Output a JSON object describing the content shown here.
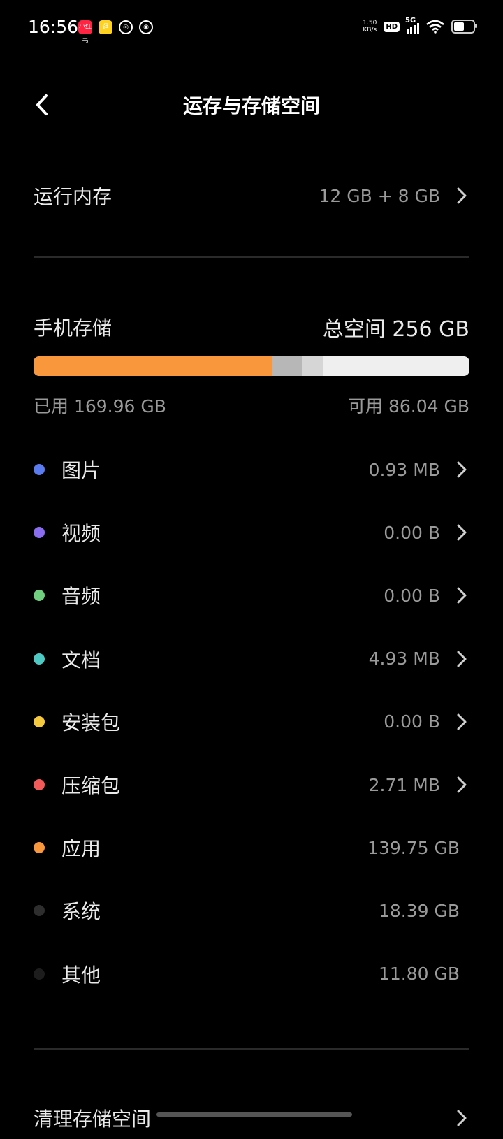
{
  "status_bar": {
    "time": "16:56",
    "notifications": [
      {
        "name": "xiaohongshu-icon",
        "glyph": "小红书",
        "color": "#ff2442"
      },
      {
        "name": "shopping-app-icon",
        "glyph": "逛",
        "color": "#ffd21f"
      },
      {
        "name": "swirl-app-icon",
        "glyph": "◎",
        "color": "#000000"
      },
      {
        "name": "cat-app-icon",
        "glyph": "◉",
        "color": "#000000"
      }
    ],
    "net_speed_value": "1.50",
    "net_speed_unit": "KB/s",
    "hd_label": "HD",
    "signal_label": "5G"
  },
  "header": {
    "title": "运存与存储空间"
  },
  "ram": {
    "label": "运行内存",
    "value": "12 GB + 8 GB"
  },
  "storage": {
    "label": "手机存储",
    "total": "总空间 256 GB",
    "used": "已用 169.96 GB",
    "free": "可用 86.04 GB",
    "bar": [
      {
        "name": "apps",
        "fraction": 0.5459,
        "color": "#f9973d"
      },
      {
        "name": "system",
        "fraction": 0.0718,
        "color": "#b7b7b7"
      },
      {
        "name": "other",
        "fraction": 0.0461,
        "color": "#d6d6d6"
      }
    ]
  },
  "categories": [
    {
      "label": "图片",
      "value": "0.93 MB",
      "color": "#5b7cf0",
      "arrow": true
    },
    {
      "label": "视频",
      "value": "0.00 B",
      "color": "#8b6df2",
      "arrow": true
    },
    {
      "label": "音频",
      "value": "0.00 B",
      "color": "#6fcf7f",
      "arrow": true
    },
    {
      "label": "文档",
      "value": "4.93 MB",
      "color": "#4fc9c4",
      "arrow": true
    },
    {
      "label": "安装包",
      "value": "0.00 B",
      "color": "#f5c93d",
      "arrow": true
    },
    {
      "label": "压缩包",
      "value": "2.71 MB",
      "color": "#f25a5a",
      "arrow": true
    },
    {
      "label": "应用",
      "value": "139.75 GB",
      "color": "#f9973d",
      "arrow": false
    },
    {
      "label": "系统",
      "value": "18.39 GB",
      "color": "#2e2e2e",
      "arrow": false
    },
    {
      "label": "其他",
      "value": "11.80 GB",
      "color": "#1d1d1d",
      "arrow": false
    }
  ],
  "cleanup": {
    "label": "清理存储空间"
  }
}
